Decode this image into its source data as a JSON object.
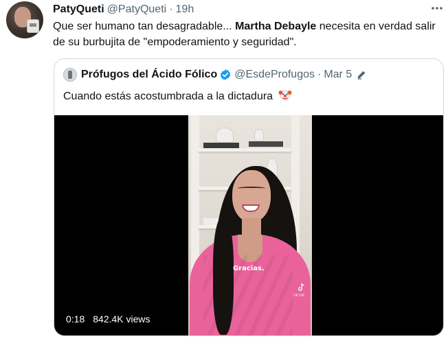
{
  "tweet": {
    "name": "PatyQueti",
    "handle": "@PatyQueti",
    "separator": "·",
    "time": "19h",
    "text_before": "Que ser humano tan desagradable... ",
    "text_bold": "Martha Debayle",
    "text_after": " necesita en verdad salir de su burbujita de \"empoderamiento y seguridad\"."
  },
  "quoted": {
    "name": "Prófugos del Ácido Fólico",
    "handle": "@EsdeProfugos",
    "separator": "·",
    "time": "Mar 5",
    "text": "Cuando estás acostumbrada a la dictadura",
    "emoji_icon": "clown-face-icon",
    "video": {
      "caption": "Gracias.",
      "watermark": "TikTok",
      "duration": "0:18",
      "views": "842.4K views"
    }
  },
  "colors": {
    "verified": "#1d9bf0",
    "secondary_text": "#536471",
    "border": "#cfd9de"
  }
}
